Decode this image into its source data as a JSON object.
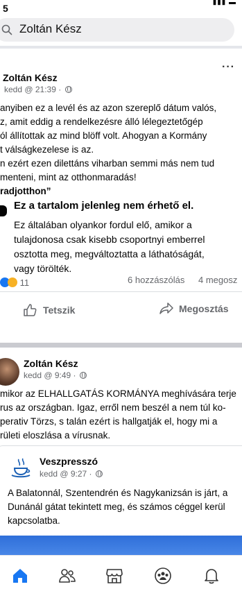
{
  "status": {
    "time": "5"
  },
  "search": {
    "query": "Zoltán Kész"
  },
  "post1": {
    "author": "Zoltán Kész",
    "timestamp": "kedd @ 21:39 ·",
    "lines": [
      "anyiben ez a levél és az azon szereplő dátum valós,",
      "z, amit eddig a rendelkezésre álló lélegeztetőgép",
      "ól állítottak az mind blöff volt. Ahogyan a Kormány",
      "t válságkezelese is az.",
      "n ezért ezen dilettáns viharban semmi más nem tud",
      "menteni, mint az otthonmaradás!",
      "radjotthon”"
    ],
    "unavailable_title": "Ez a tartalom jelenleg nem érhető el.",
    "unavailable_lines": [
      "Ez általában olyankor fordul elő, amikor a",
      "tulajdonosa csak kisebb csoportnyi emberrel",
      "osztotta meg, megváltoztatta a láthatóságát,",
      "vagy törölték."
    ],
    "reaction_count": "11",
    "comments": "6 hozzászólás",
    "shares": "4 megosz",
    "like_label": "Tetszik",
    "share_label": "Megosztás"
  },
  "post2": {
    "author": "Zoltán Kész",
    "timestamp": "kedd @ 9:49 ·",
    "lines": [
      "mikor az ELHALLGATÁS KORMÁNYA meghívására terje",
      "rus az országban. Igaz, erről nem beszél a nem túl ko-",
      "perativ Törzs, s talán ezért is hallgatják el, hogy mi a",
      "rületi eloszlása a vírusnak."
    ],
    "shared": {
      "author": "Veszpresszó",
      "timestamp": "kedd @ 9:27 ·",
      "lines": [
        "A Balatonnál, Szentendrén és Nagykanizsán is járt, a",
        "Dunánál gátat tekintett meg, és számos céggel kerül",
        "kapcsolatba."
      ]
    }
  },
  "colors": {
    "accent": "#1877f2",
    "muted": "#65676b",
    "divider": "#cacbd0"
  },
  "nav": [
    "home-icon",
    "friends-icon",
    "marketplace-icon",
    "groups-icon",
    "notifications-icon"
  ]
}
